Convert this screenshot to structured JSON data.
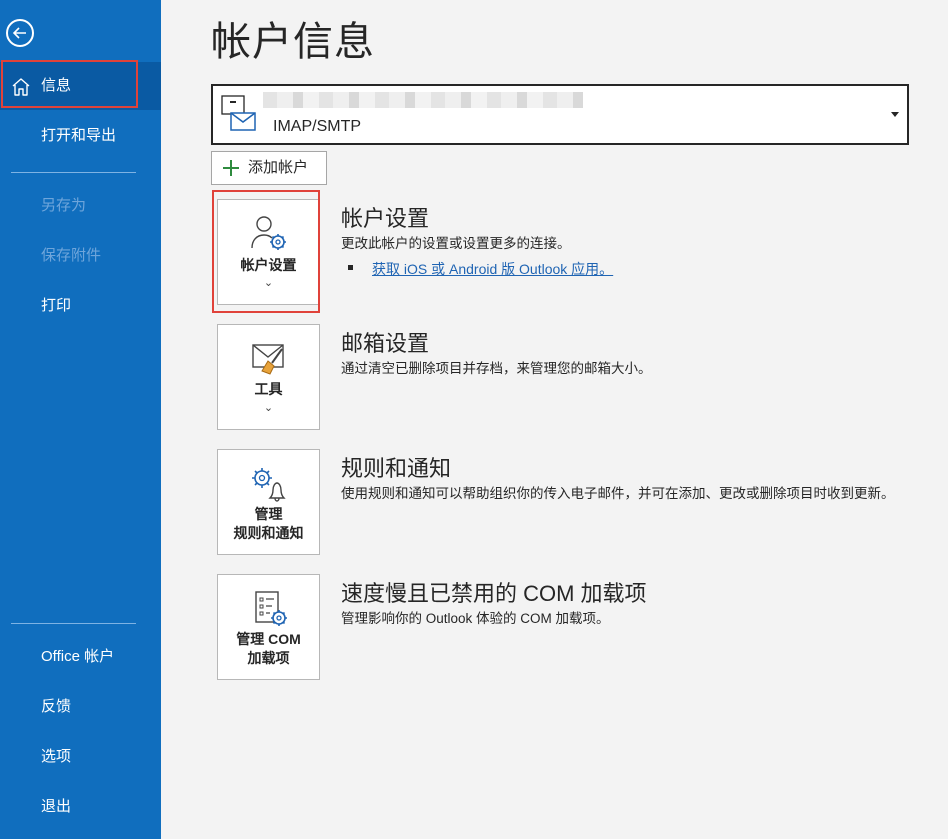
{
  "sidebar": {
    "back_icon": "back-arrow-icon",
    "items": [
      {
        "label": "信息",
        "icon": "home-icon"
      },
      {
        "label": "打开和导出"
      },
      {
        "label": "另存为"
      },
      {
        "label": "保存附件"
      },
      {
        "label": "打印"
      },
      {
        "label": "Office 帐户"
      },
      {
        "label": "反馈"
      },
      {
        "label": "选项"
      },
      {
        "label": "退出"
      }
    ]
  },
  "main": {
    "title": "帐户信息",
    "account": {
      "type": "IMAP/SMTP"
    },
    "add_account_label": "添加帐户",
    "sections": [
      {
        "tile_label": "帐户设置",
        "title": "帐户设置",
        "description": "更改此帐户的设置或设置更多的连接。",
        "link": "获取 iOS 或 Android 版 Outlook 应用。"
      },
      {
        "tile_label": "工具",
        "title": "邮箱设置",
        "description": "通过清空已删除项目并存档，来管理您的邮箱大小。"
      },
      {
        "tile_label_line1": "管理",
        "tile_label_line2": "规则和通知",
        "title": "规则和通知",
        "description": "使用规则和通知可以帮助组织你的传入电子邮件，并可在添加、更改或删除项目时收到更新。"
      },
      {
        "tile_label_line1": "管理 COM",
        "tile_label_line2": "加载项",
        "title": "速度慢且已禁用的 COM 加载项",
        "description": "管理影响你的 Outlook 体验的 COM 加载项。"
      }
    ]
  },
  "colors": {
    "sidebar_bg": "#106ebe",
    "sidebar_active": "#0a5aa3",
    "highlight": "#e0423a",
    "link": "#1f64b3",
    "gear_accent": "#1f64b3"
  }
}
